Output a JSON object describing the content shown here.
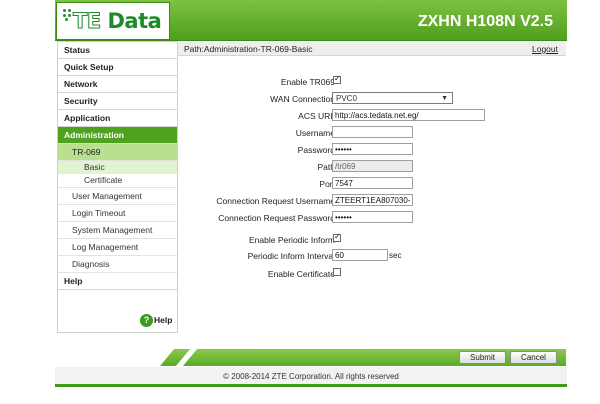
{
  "brand": {
    "logo": "TE Data",
    "model": "ZXHN H108N V2.5"
  },
  "nav": {
    "status": "Status",
    "quick_setup": "Quick Setup",
    "network": "Network",
    "security": "Security",
    "application": "Application",
    "administration": "Administration",
    "tr069": "TR-069",
    "basic": "Basic",
    "certificate": "Certificate",
    "user_management": "User Management",
    "login_timeout": "Login Timeout",
    "system_management": "System Management",
    "log_management": "Log Management",
    "diagnosis": "Diagnosis",
    "help": "Help",
    "help_link": "Help"
  },
  "path": {
    "text": "Path:Administration-TR-069-Basic",
    "logout": "Logout"
  },
  "form": {
    "enable_tr069_label": "Enable TR069",
    "enable_tr069_checked": true,
    "wan_connection_label": "WAN Connection",
    "wan_connection_value": "PVC0",
    "acs_url_label": "ACS URL",
    "acs_url_value": "http://acs.tedata.net.eg/",
    "username_label": "Username",
    "username_value": "",
    "password_label": "Password",
    "password_value": "••••••",
    "path_label": "Path",
    "path_value": "/tr069",
    "port_label": "Port",
    "port_value": "7547",
    "conn_req_username_label": "Connection Request Username",
    "conn_req_username_value": "ZTEERT1EA807030-",
    "conn_req_password_label": "Connection Request Password",
    "conn_req_password_value": "••••••",
    "enable_periodic_label": "Enable Periodic Inform",
    "enable_periodic_checked": true,
    "periodic_interval_label": "Periodic Inform Interval",
    "periodic_interval_value": "60",
    "periodic_interval_unit": "sec",
    "enable_certificate_label": "Enable Certificate",
    "enable_certificate_checked": false
  },
  "buttons": {
    "submit": "Submit",
    "cancel": "Cancel"
  },
  "footer": {
    "copyright": "© 2008-2014 ZTE Corporation. All rights reserved"
  },
  "colors": {
    "accent": "#4fa21d",
    "header_top": "#7fc142",
    "header_bottom": "#4f9f1d",
    "sub_active": "#b9e08f"
  }
}
